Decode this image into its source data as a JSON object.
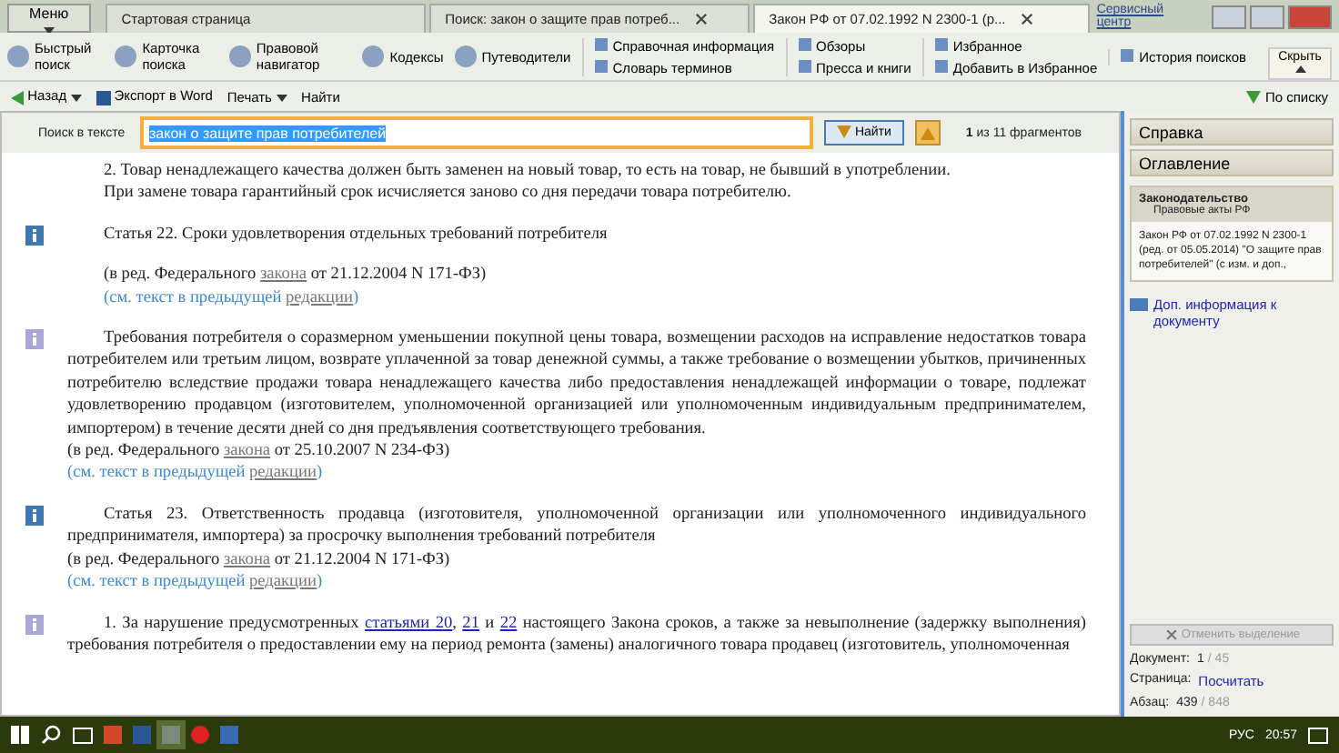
{
  "menu_button": "Меню",
  "tabs": [
    {
      "label": "Стартовая страница",
      "selected": false,
      "closable": false
    },
    {
      "label": "Поиск: закон о защите прав потреб...",
      "selected": false,
      "closable": true
    },
    {
      "label": "Закон РФ от 07.02.1992 N 2300-1 (р...",
      "selected": true,
      "closable": true
    }
  ],
  "service_link": "Сервисный центр",
  "ribbon": [
    {
      "label": "Быстрый поиск"
    },
    {
      "label": "Карточка поиска"
    },
    {
      "label": "Правовой навигатор"
    },
    {
      "label": "Кодексы"
    },
    {
      "label": "Путеводители"
    }
  ],
  "ribbon_small": [
    [
      "Справочная информация",
      "Словарь терминов"
    ],
    [
      "Обзоры",
      "Пресса и книги"
    ],
    [
      "Избранное",
      "Добавить в Избранное"
    ],
    [
      "История поисков"
    ]
  ],
  "hide_button": "Скрыть",
  "nav": {
    "back": "Назад",
    "export": "Экспорт в Word",
    "print": "Печать",
    "find": "Найти",
    "by_list": "По списку"
  },
  "search": {
    "label": "Поиск в тексте",
    "value": "закон о защите прав потребителей",
    "button": "Найти",
    "result": "**1** из 11 фрагментов"
  },
  "document": [
    {
      "kind": "plain",
      "indented": true,
      "spaced": false,
      "parts": [
        {
          "kind": "text",
          "t": "2. Товар ненадлежащего качества должен быть заменен на новый товар, то есть на товар, не бывший в употреблении."
        }
      ]
    },
    {
      "kind": "plain",
      "indented": true,
      "spaced": false,
      "parts": [
        {
          "kind": "text",
          "t": "При замене товара гарантийный срок исчисляется заново со дня передачи товара потребителю."
        }
      ]
    },
    {
      "kind": "article",
      "indented": true,
      "spaced": true,
      "parts": [
        {
          "kind": "text",
          "t": "Статья 22. Сроки удовлетворения отдельных требований потребителя"
        }
      ]
    },
    {
      "kind": "plain",
      "indented": true,
      "spaced": true,
      "parts": [
        {
          "kind": "text",
          "t": "(в ред. Федерального "
        },
        {
          "kind": "edition_link",
          "t": "закона"
        },
        {
          "kind": "text",
          "t": " от 21.12.2004 N 171-ФЗ)"
        }
      ]
    },
    {
      "kind": "see_also",
      "indented": true,
      "spaced": false,
      "parts": [
        {
          "kind": "text",
          "t": "(см. текст в предыдущей "
        },
        {
          "kind": "edition_link",
          "t": "редакции"
        },
        {
          "kind": "text",
          "t": ")"
        }
      ]
    },
    {
      "kind": "annotated",
      "indented": true,
      "spaced": true,
      "parts": [
        {
          "kind": "text",
          "t": "Требования потребителя о соразмерном уменьшении покупной цены товара, возмещении расходов на исправление недостатков товара потребителем или третьим лицом, возврате уплаченной за товар денежной суммы, а также требование о возмещении убытков, причиненных потребителю вследствие продажи товара ненадлежащего качества либо предоставления ненадлежащей информации о товаре, подлежат удовлетворению продавцом (изготовителем, уполномоченной организацией или уполномоченным индивидуальным предпринимателем, импортером) в течение десяти дней со дня предъявления соответствующего требования."
        }
      ]
    },
    {
      "kind": "plain",
      "indented": false,
      "spaced": false,
      "parts": [
        {
          "kind": "text",
          "t": "(в ред. Федерального "
        },
        {
          "kind": "edition_link",
          "t": "закона"
        },
        {
          "kind": "text",
          "t": " от 25.10.2007 N 234-ФЗ)"
        }
      ]
    },
    {
      "kind": "see_also",
      "indented": false,
      "spaced": false,
      "parts": [
        {
          "kind": "text",
          "t": "(см. текст в предыдущей "
        },
        {
          "kind": "edition_link",
          "t": "редакции"
        },
        {
          "kind": "text",
          "t": ")"
        }
      ]
    },
    {
      "kind": "article",
      "indented": true,
      "spaced": true,
      "parts": [
        {
          "kind": "text",
          "t": "Статья 23. Ответственность продавца (изготовителя, уполномоченной организации или уполномоченного индивидуального предпринимателя, импортера) за просрочку выполнения требований потребителя"
        }
      ]
    },
    {
      "kind": "plain",
      "indented": false,
      "spaced": false,
      "parts": [
        {
          "kind": "text",
          "t": "(в ред. Федерального "
        },
        {
          "kind": "edition_link",
          "t": "закона"
        },
        {
          "kind": "text",
          "t": " от 21.12.2004 N 171-ФЗ)"
        }
      ]
    },
    {
      "kind": "see_also",
      "indented": false,
      "spaced": false,
      "parts": [
        {
          "kind": "text",
          "t": "(см. текст в предыдущей "
        },
        {
          "kind": "edition_link",
          "t": "редакции"
        },
        {
          "kind": "text",
          "t": ")"
        }
      ]
    },
    {
      "kind": "annotated",
      "indented": true,
      "spaced": true,
      "parts": [
        {
          "kind": "text",
          "t": "1. За нарушение предусмотренных "
        },
        {
          "kind": "link",
          "t": "статьями 20"
        },
        {
          "kind": "text",
          "t": ", "
        },
        {
          "kind": "link",
          "t": "21"
        },
        {
          "kind": "text",
          "t": " и "
        },
        {
          "kind": "link",
          "t": "22"
        },
        {
          "kind": "text",
          "t": " настоящего Закона сроков, а также за невыполнение (задержку выполнения) требования потребителя о предоставлении ему на период ремонта (замены) аналогичного товара продавец (изготовитель, уполномоченная"
        }
      ]
    }
  ],
  "side": {
    "buttons": [
      "Справка",
      "Оглавление"
    ],
    "card_title": "Законодательство",
    "card_subtitle": "Правовые акты РФ",
    "card_text": "Закон РФ от 07.02.1992 N 2300-1 (ред. от 05.05.2014) \"О защите прав потребителей\" (с изм. и доп.,",
    "info_link": "Доп. информация к документу",
    "clear_button": "Отменить выделение",
    "clear_disabled": true,
    "stats": [
      {
        "label": "Документ:",
        "value": "1",
        "total": "/ 45"
      },
      {
        "label": "Страница:",
        "link": "Посчитать"
      },
      {
        "label": "Абзац:",
        "value": "439",
        "total": "/ 848"
      }
    ]
  },
  "taskbar": {
    "language": "РУС",
    "time": "20:57"
  }
}
